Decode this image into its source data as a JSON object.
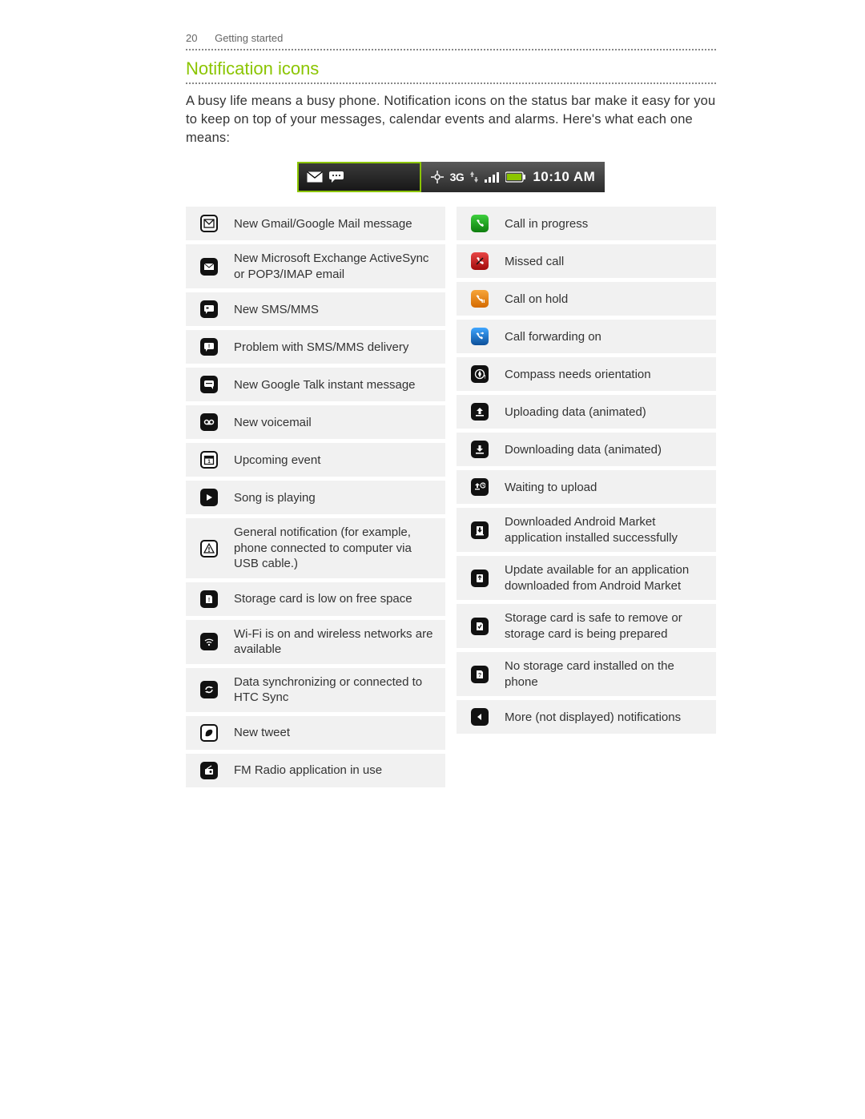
{
  "header": {
    "page_number": "20",
    "section": "Getting started"
  },
  "heading": "Notification icons",
  "body_text": "A busy life means a busy phone. Notification icons on the status bar make it easy for you to keep on top of your messages, calendar events and alarms. Here's what each one means:",
  "status_bar": {
    "network_label": "3G",
    "time": "10:10 AM"
  },
  "left_column": [
    {
      "icon": "gmail",
      "style": "white-border",
      "label": "New Gmail/Google Mail message"
    },
    {
      "icon": "mail",
      "style": "black",
      "label": "New Microsoft Exchange ActiveSync or POP3/IMAP email"
    },
    {
      "icon": "sms",
      "style": "black",
      "label": "New SMS/MMS"
    },
    {
      "icon": "sms-problem",
      "style": "black",
      "label": "Problem with SMS/MMS delivery"
    },
    {
      "icon": "talk",
      "style": "black",
      "label": "New Google Talk instant message"
    },
    {
      "icon": "voicemail",
      "style": "black",
      "label": "New voicemail"
    },
    {
      "icon": "calendar",
      "style": "white-border",
      "label": "Upcoming event"
    },
    {
      "icon": "play",
      "style": "black",
      "label": "Song is playing"
    },
    {
      "icon": "alert",
      "style": "white-border",
      "label": "General notification (for example, phone connected to computer via USB cable.)"
    },
    {
      "icon": "sd-low",
      "style": "black",
      "label": "Storage card is low on free space"
    },
    {
      "icon": "wifi",
      "style": "black",
      "label": "Wi-Fi is on and wireless networks are available"
    },
    {
      "icon": "sync",
      "style": "black",
      "label": "Data synchronizing or connected to HTC Sync"
    },
    {
      "icon": "tweet",
      "style": "white-border",
      "label": "New tweet"
    },
    {
      "icon": "radio",
      "style": "black",
      "label": "FM Radio application in use"
    }
  ],
  "right_column": [
    {
      "icon": "call",
      "style": "green",
      "label": "Call in progress"
    },
    {
      "icon": "missed-call",
      "style": "red",
      "label": "Missed call"
    },
    {
      "icon": "call-hold",
      "style": "orange",
      "label": "Call on hold"
    },
    {
      "icon": "call-forward",
      "style": "blue",
      "label": "Call forwarding on"
    },
    {
      "icon": "compass",
      "style": "black",
      "label": "Compass needs orientation"
    },
    {
      "icon": "upload",
      "style": "black",
      "label": "Uploading data (animated)"
    },
    {
      "icon": "download",
      "style": "black",
      "label": "Downloading data (animated)"
    },
    {
      "icon": "upload-wait",
      "style": "black",
      "label": "Waiting to upload"
    },
    {
      "icon": "installed",
      "style": "black",
      "label": "Downloaded Android Market application installed successfully"
    },
    {
      "icon": "update",
      "style": "black",
      "label": "Update available for an application downloaded from Android Market"
    },
    {
      "icon": "sd-safe",
      "style": "black",
      "label": "Storage card is safe to remove or storage card is being prepared"
    },
    {
      "icon": "sd-none",
      "style": "black",
      "label": "No storage card installed on the phone"
    },
    {
      "icon": "more",
      "style": "black",
      "label": "More (not displayed) notifications"
    }
  ]
}
